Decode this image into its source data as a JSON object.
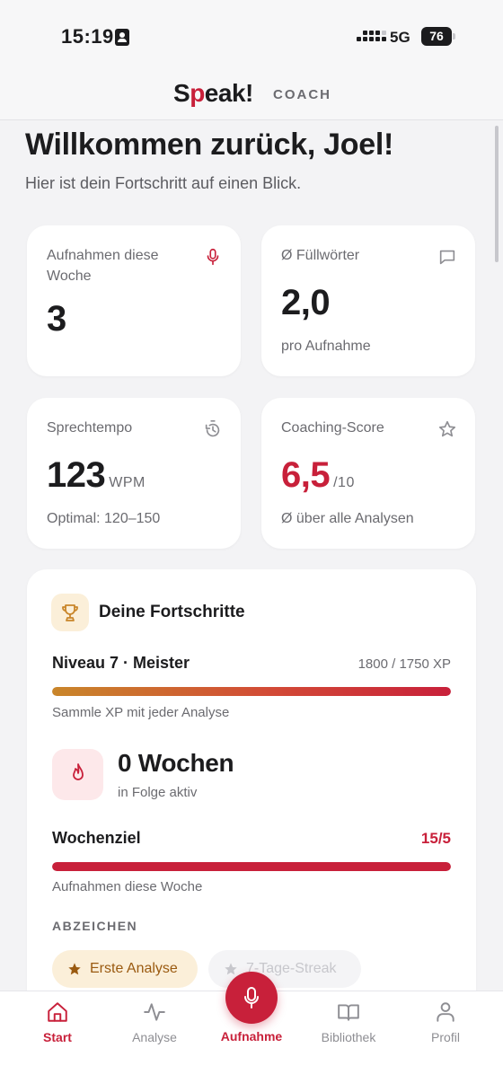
{
  "status_bar": {
    "time": "15:19",
    "network": "5G",
    "battery": "76"
  },
  "header": {
    "logo_pre": "S",
    "logo_p": "p",
    "logo_post": "eak!",
    "logo_sub": "COACH"
  },
  "welcome": {
    "title": "Willkommen zurück, Joel!",
    "subtitle": "Hier ist dein Fortschritt auf einen Blick."
  },
  "stats": {
    "recordings": {
      "label": "Aufnahmen diese Woche",
      "value": "3",
      "icon": "microphone-icon"
    },
    "fillers": {
      "label": "Ø Füllwörter",
      "value": "2,0",
      "foot": "pro Aufnahme",
      "icon": "message-icon"
    },
    "tempo": {
      "label": "Sprechtempo",
      "value": "123",
      "unit": "WPM",
      "foot": "Optimal: 120–150",
      "icon": "timer-icon"
    },
    "score": {
      "label": "Coaching-Score",
      "value": "6,5",
      "unit": "/10",
      "foot": "Ø über alle Analysen",
      "icon": "star-icon"
    }
  },
  "progress": {
    "title": "Deine Fortschritte",
    "level_label": "Niveau 7 · Meister",
    "xp_text": "1800 / 1750 XP",
    "xp_fraction": 1.0,
    "xp_note": "Sammle XP mit jeder Analyse",
    "streak_value": "0 Wochen",
    "streak_sub": "in Folge aktiv",
    "goal_label": "Wochenziel",
    "goal_value": "15/5",
    "goal_fraction": 1.0,
    "goal_note": "Aufnahmen diese Woche",
    "badges_title": "ABZEICHEN",
    "badges": [
      {
        "label": "Erste Analyse",
        "earned": true
      },
      {
        "label": "7-Tage-Streak",
        "earned": false
      }
    ]
  },
  "tabs": [
    {
      "label": "Start",
      "icon": "home-icon",
      "active": true
    },
    {
      "label": "Analyse",
      "icon": "activity-icon",
      "active": false
    },
    {
      "label": "Aufnahme",
      "icon": "microphone-icon",
      "active": false
    },
    {
      "label": "Bibliothek",
      "icon": "book-icon",
      "active": false
    },
    {
      "label": "Profil",
      "icon": "user-icon",
      "active": false
    }
  ],
  "colors": {
    "accent": "#c8203a",
    "gold": "#c9862a",
    "background": "#f3f3f5"
  }
}
